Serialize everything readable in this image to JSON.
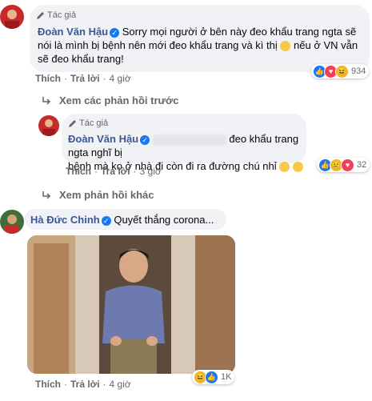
{
  "comment1": {
    "tag": "Tác giả",
    "name": "Đoàn Văn Hậu",
    "line1": "Sorry mọi người ở bên này đeo khẩu trang ngta sẽ",
    "line2a": "nói là mình bị bệnh nên mới đeo khẩu trang và kì thị",
    "line2b": "nếu ở VN vẫn",
    "line3": "sẽ đeo khẩu trang!",
    "like_label": "Thích",
    "reply_label": "Trả lời",
    "time": "4 giờ",
    "reaction_count": "934"
  },
  "prev_replies_label": "Xem các phản hồi trước",
  "reply1": {
    "tag": "Tác giả",
    "name": "Đoàn Văn Hậu",
    "line1": "đeo khẩu trang ngta nghĩ bị",
    "line2": "bệnh mà ko ở nhà đi còn đi ra đường chú nhỉ",
    "like_label": "Thích",
    "reply_label": "Trả lời",
    "time": "3 giờ",
    "reaction_count": "32"
  },
  "more_replies_label": "Xem phản hồi khác",
  "comment2": {
    "name": "Hà Đức Chinh",
    "text": "Quyết thắng corona...",
    "like_label": "Thích",
    "reply_label": "Trả lời",
    "time": "4 giờ",
    "reaction_count": "1K"
  },
  "colors": {
    "name": "#385898",
    "bubble": "#f0f2f5",
    "like": "#1877f2",
    "love": "#f33e58",
    "haha": "#f7b125"
  }
}
